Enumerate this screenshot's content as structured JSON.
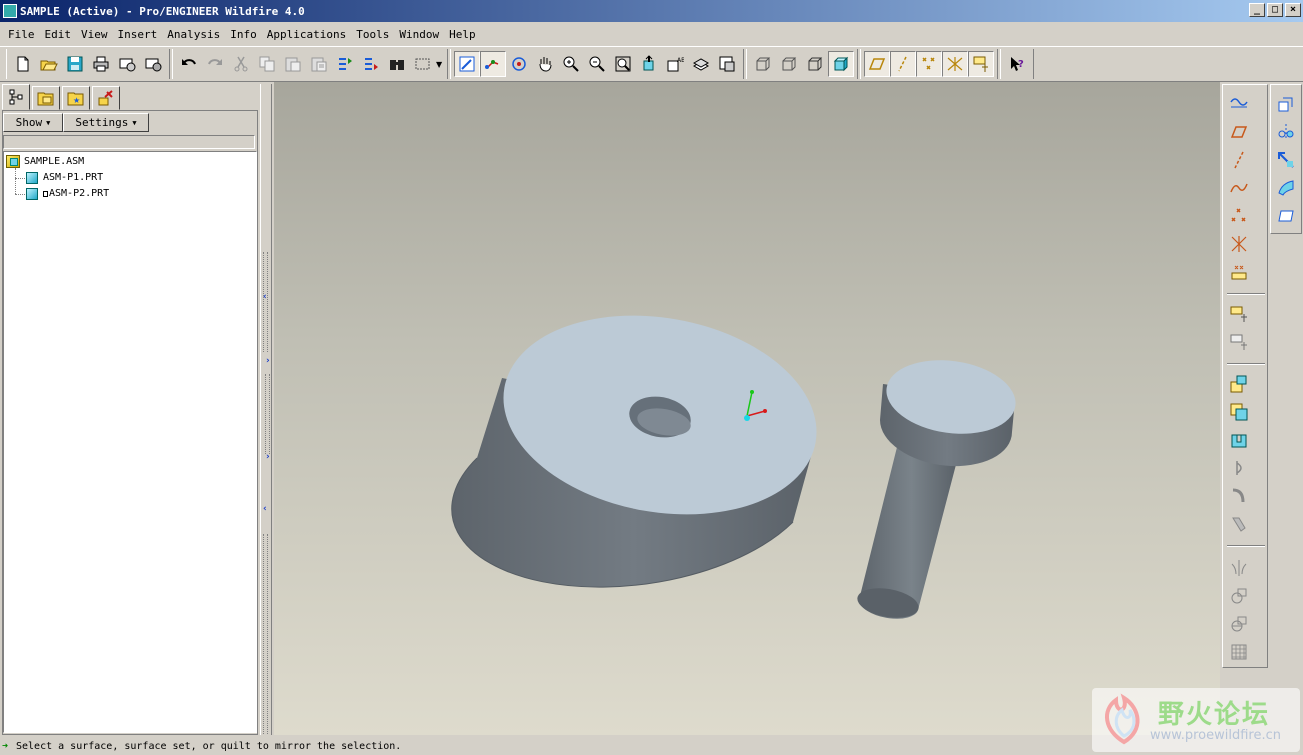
{
  "window": {
    "title": "SAMPLE (Active) - Pro/ENGINEER Wildfire 4.0",
    "controls": [
      "_",
      "□",
      "×"
    ]
  },
  "menu": [
    {
      "label": "File"
    },
    {
      "label": "Edit"
    },
    {
      "label": "View"
    },
    {
      "label": "Insert"
    },
    {
      "label": "Analysis"
    },
    {
      "label": "Info"
    },
    {
      "label": "Applications"
    },
    {
      "label": "Tools"
    },
    {
      "label": "Window"
    },
    {
      "label": "Help"
    }
  ],
  "toolbar_icons": [
    "new-icon",
    "open-icon",
    "save-icon",
    "print-icon",
    "email-icon",
    "email-link-icon",
    "undo-icon",
    "redo-icon",
    "cut-icon",
    "copy-icon",
    "paste-icon",
    "paste-special-icon",
    "regenerate-icon",
    "regen-manager-icon",
    "find-icon",
    "select-box-icon",
    "repaint-icon",
    "spin-center-icon",
    "orient-mode-icon",
    "pan-icon",
    "zoom-in-icon",
    "zoom-out-icon",
    "refit-icon",
    "reorient-icon",
    "saved-views-icon",
    "layers-icon",
    "view-manager-icon",
    "wireframe-icon",
    "hidden-line-icon",
    "no-hidden-icon",
    "shading-icon",
    "datum-planes-icon",
    "datum-axes-icon",
    "datum-points-icon",
    "coord-sys-icon",
    "annotations-icon",
    "context-help-icon"
  ],
  "navigator": {
    "tabs": [
      "model-tree-tab",
      "folder-browser-tab",
      "favorites-tab",
      "connections-tab"
    ],
    "show_label": "Show",
    "settings_label": "Settings",
    "tree": [
      {
        "label": "SAMPLE.ASM",
        "type": "asm"
      },
      {
        "label": "ASM-P1.PRT",
        "type": "prt"
      },
      {
        "label": "ASM-P2.PRT",
        "type": "prt"
      }
    ]
  },
  "statusbar": {
    "message": "Select a surface, surface set, or quilt to mirror the selection."
  },
  "watermark": {
    "title": "野火论坛",
    "url": "www.proewildfire.cn"
  },
  "colors": {
    "part_top": "#bccad6",
    "part_side": "#6b737a",
    "background_top": "#a7a69c",
    "background_bottom": "#dedbcd"
  }
}
